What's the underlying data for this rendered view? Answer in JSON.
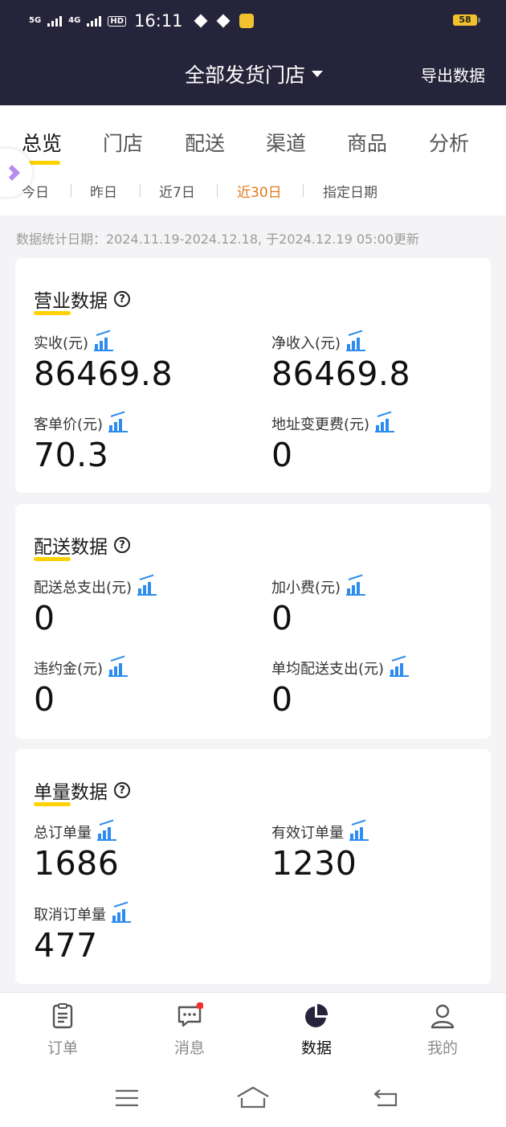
{
  "status_bar": {
    "time": "16:11",
    "network_1": "5G",
    "network_2": "4G",
    "hd": "HD",
    "battery": "58"
  },
  "header": {
    "store_selector": "全部发货门店",
    "export_label": "导出数据"
  },
  "tabs": [
    {
      "label": "总览",
      "active": true
    },
    {
      "label": "门店"
    },
    {
      "label": "配送"
    },
    {
      "label": "渠道"
    },
    {
      "label": "商品"
    },
    {
      "label": "分析"
    }
  ],
  "date_filters": [
    {
      "label": "今日"
    },
    {
      "label": "昨日"
    },
    {
      "label": "近7日"
    },
    {
      "label": "近30日",
      "active": true
    },
    {
      "label": "指定日期"
    }
  ],
  "stat_date_text": "数据统计日期：2024.11.19-2024.12.18, 于2024.12.19 05:00更新",
  "sections": {
    "business": {
      "title_hl": "营业",
      "title_rest": "数据",
      "metrics": [
        {
          "label": "实收(元)",
          "value": "86469.8"
        },
        {
          "label": "净收入(元)",
          "value": "86469.8"
        },
        {
          "label": "客单价(元)",
          "value": "70.3"
        },
        {
          "label": "地址变更费(元)",
          "value": "0"
        }
      ]
    },
    "delivery": {
      "title_hl": "配送",
      "title_rest": "数据",
      "metrics": [
        {
          "label": "配送总支出(元)",
          "value": "0"
        },
        {
          "label": "加小费(元)",
          "value": "0"
        },
        {
          "label": "违约金(元)",
          "value": "0"
        },
        {
          "label": "单均配送支出(元)",
          "value": "0"
        }
      ]
    },
    "orders": {
      "title_hl": "单量",
      "title_rest": "数据",
      "metrics": [
        {
          "label": "总订单量",
          "value": "1686"
        },
        {
          "label": "有效订单量",
          "value": "1230"
        },
        {
          "label": "取消订单量",
          "value": "477"
        }
      ]
    }
  },
  "help_glyph": "?",
  "bottom_nav": [
    {
      "label": "订单",
      "icon": "order-icon"
    },
    {
      "label": "消息",
      "icon": "message-icon",
      "badge": true
    },
    {
      "label": "数据",
      "icon": "data-pie-icon",
      "active": true
    },
    {
      "label": "我的",
      "icon": "profile-icon"
    }
  ],
  "colors": {
    "header_bg": "#25243a",
    "accent_yellow": "#ffd100",
    "active_date": "#e07a1c",
    "chart_icon_blue": "#2d8cf0",
    "badge_red": "#f23030"
  }
}
